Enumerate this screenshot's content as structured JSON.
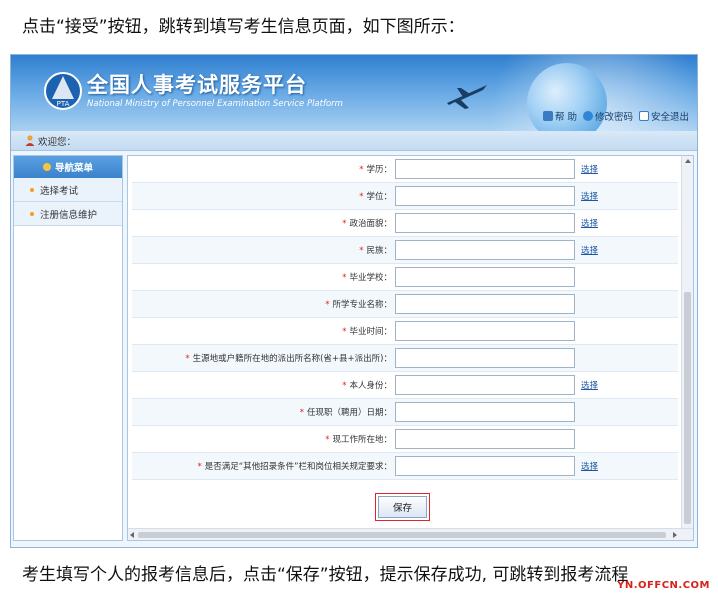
{
  "captions": {
    "top": "点击“接受”按钮，跳转到填写考生信息页面，如下图所示：",
    "bottom": "考生填写个人的报考信息后，点击“保存”按钮，提示保存成功, 可跳转到报考流程",
    "watermark": "YN.OFFCN.COM"
  },
  "header": {
    "title": "全国人事考试服务平台",
    "subtitle": "National Ministry of Personnel Examination Service Platform",
    "logo_text": "PTA",
    "links": [
      {
        "label": "帮 助",
        "icon": "help-icon"
      },
      {
        "label": "修改密码",
        "icon": "key-icon"
      },
      {
        "label": "安全退出",
        "icon": "exit-icon"
      }
    ]
  },
  "welcome": {
    "text": "欢迎您："
  },
  "sidebar": {
    "title": "导航菜单",
    "items": [
      {
        "label": "选择考试"
      },
      {
        "label": "注册信息维护"
      }
    ]
  },
  "form": {
    "select_label": "选择",
    "rows": [
      {
        "label": "学历：",
        "has_select": true
      },
      {
        "label": "学位：",
        "has_select": true
      },
      {
        "label": "政治面貌：",
        "has_select": true
      },
      {
        "label": "民族：",
        "has_select": true
      },
      {
        "label": "毕业学校：",
        "has_select": false
      },
      {
        "label": "所学专业名称：",
        "has_select": false
      },
      {
        "label": "毕业时间：",
        "has_select": false
      },
      {
        "label": "生源地或户籍所在地的派出所名称(省+县+派出所)：",
        "has_select": false
      },
      {
        "label": "本人身份：",
        "has_select": true
      },
      {
        "label": "任现职（聘用）日期：",
        "has_select": false
      },
      {
        "label": "现工作所在地：",
        "has_select": false
      },
      {
        "label": "是否满足“其他招录条件”栏和岗位相关规定要求：",
        "has_select": true
      }
    ],
    "save_label": "保存"
  },
  "colors": {
    "accent": "#3a82cc",
    "highlight_border": "#e0262a",
    "link": "#1d56a5"
  }
}
